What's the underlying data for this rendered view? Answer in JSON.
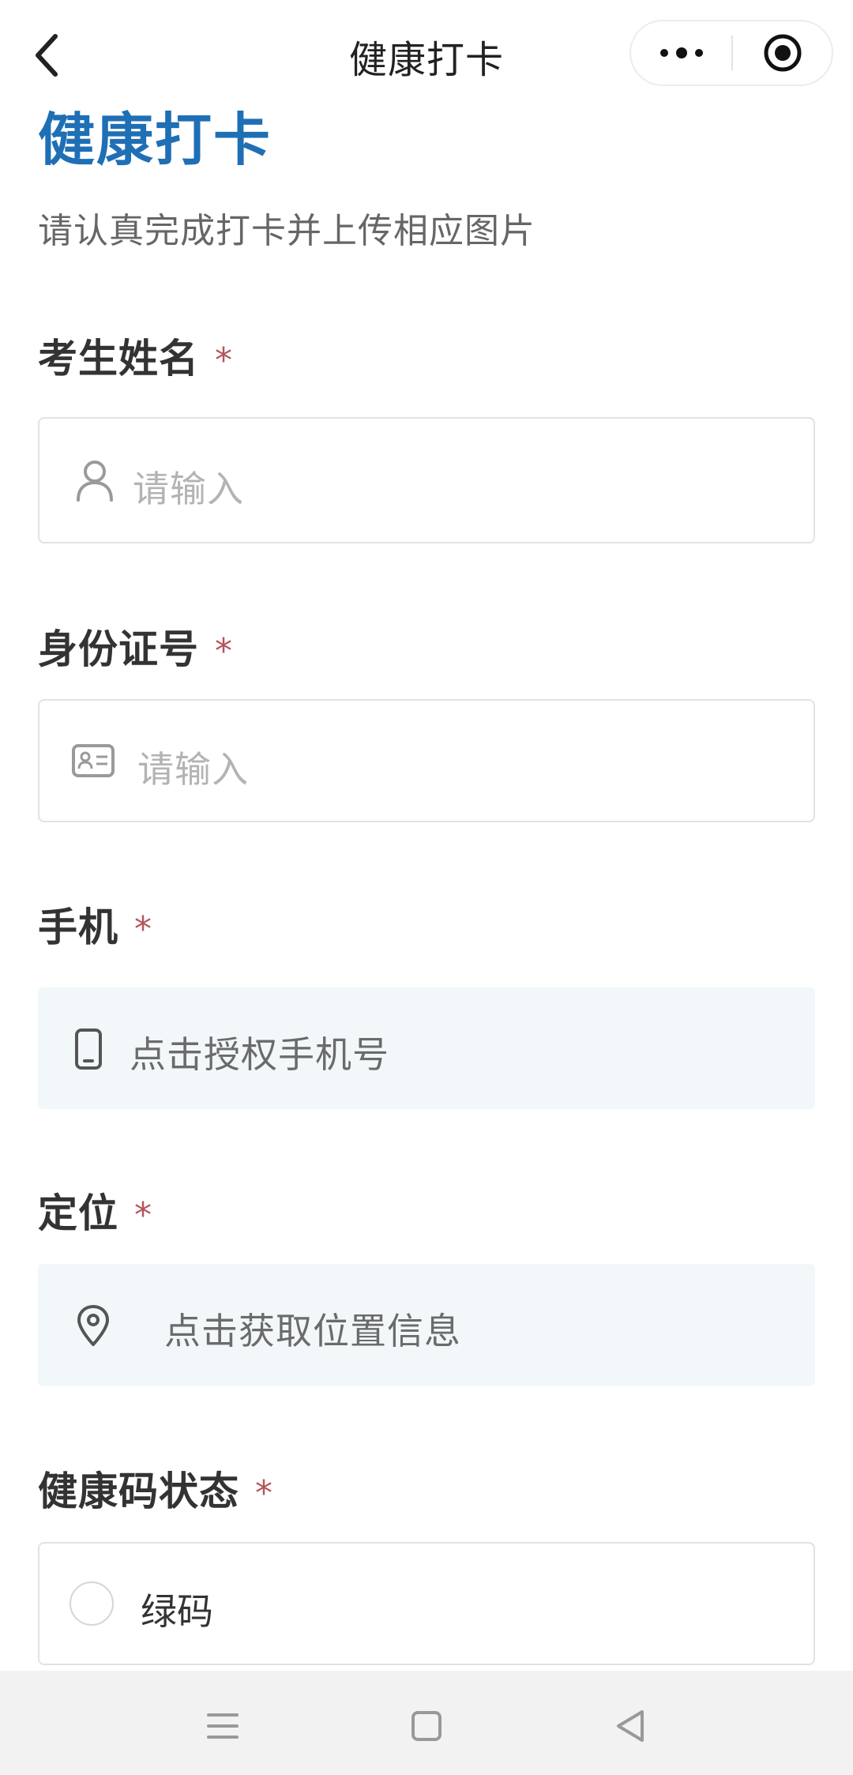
{
  "nav": {
    "title": "健康打卡"
  },
  "header": {
    "title": "健康打卡",
    "subtitle": "请认真完成打卡并上传相应图片"
  },
  "form": {
    "name": {
      "label": "考生姓名",
      "required_mark": "*",
      "placeholder": "请输入",
      "icon": "person-icon"
    },
    "id_number": {
      "label": "身份证号",
      "required_mark": "*",
      "placeholder": "请输入",
      "icon": "id-card-icon"
    },
    "phone": {
      "label": "手机",
      "required_mark": "*",
      "action_text": "点击授权手机号",
      "icon": "phone-icon"
    },
    "location": {
      "label": "定位",
      "required_mark": "*",
      "action_text": "点击获取位置信息",
      "icon": "location-pin-icon"
    },
    "health_code": {
      "label": "健康码状态",
      "required_mark": "*",
      "options": [
        {
          "label": "绿码",
          "selected": false
        }
      ]
    }
  },
  "colors": {
    "accent": "#1f6fb5",
    "required": "#b5545c",
    "auth_background": "#f2f8fa"
  }
}
